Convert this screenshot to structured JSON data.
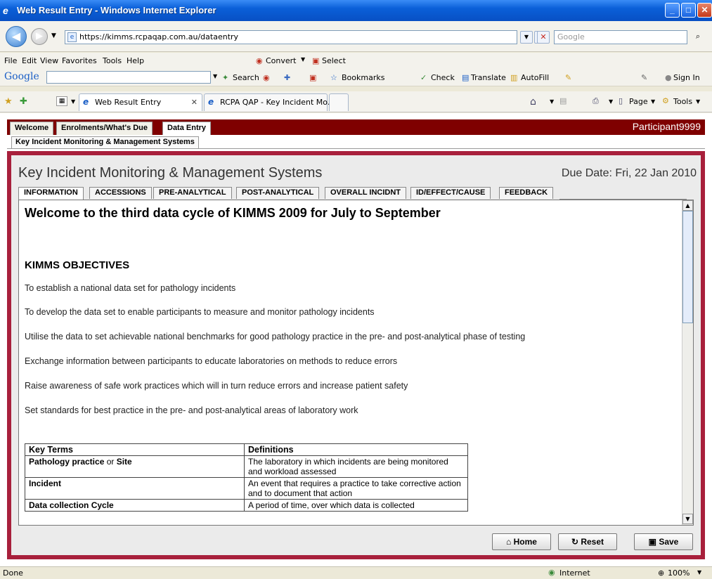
{
  "window": {
    "title": "Web Result Entry - Windows Internet Explorer"
  },
  "address": {
    "url": "https://kimms.rcpaqap.com.au/dataentry",
    "search_placeholder": "Google"
  },
  "menu": [
    "File",
    "Edit",
    "View",
    "Favorites",
    "Tools",
    "Help"
  ],
  "menu_extra": {
    "convert": "Convert",
    "select": "Select"
  },
  "google_bar": {
    "logo": "Google",
    "search": "Search",
    "bookmarks": "Bookmarks",
    "check": "Check",
    "translate": "Translate",
    "autofill": "AutoFill",
    "signin": "Sign In"
  },
  "browser_tabs": [
    {
      "label": "Web Result Entry",
      "active": true
    },
    {
      "label": "RCPA QAP - Key Incident Mo...",
      "active": false
    }
  ],
  "command_bar": {
    "page": "Page",
    "tools": "Tools"
  },
  "site": {
    "tabs": [
      "Welcome",
      "Enrolments/What's Due",
      "Data Entry"
    ],
    "active_tab": "Data Entry",
    "participant": "Participant9999",
    "subtab": "Key Incident Monitoring & Management Systems"
  },
  "panel": {
    "heading": "Key Incident Monitoring & Management Systems",
    "due_date": "Due Date: Fri, 22 Jan 2010",
    "tabs": [
      "INFORMATION",
      "ACCESSIONS",
      "PRE-ANALYTICAL",
      "POST-ANALYTICAL",
      "OVERALL INCIDNT",
      "ID/EFFECT/CAUSE",
      "FEEDBACK"
    ],
    "active_tab": "INFORMATION"
  },
  "content": {
    "welcome": "Welcome to the third data cycle of KIMMS 2009 for July to September",
    "objectives_heading": "KIMMS OBJECTIVES",
    "objectives": [
      "To establish a national data set for pathology incidents",
      "To develop the data set to enable participants to measure and monitor pathology incidents",
      "Utilise the data to set achievable national benchmarks for good pathology practice in the pre- and post-analytical phase of testing",
      "Exchange information between participants to educate laboratories on methods to reduce errors",
      "Raise awareness of safe work practices which will in turn reduce errors and increase patient safety",
      "Set standards for best practice in the pre- and post-analytical areas of laboratory work"
    ],
    "table": {
      "headers": [
        "Key Terms",
        "Definitions"
      ],
      "rows": [
        {
          "term_bold": "Pathology practice",
          "term_join": " or ",
          "term_bold2": "Site",
          "definition": "The laboratory in which incidents are being monitored and workload assessed"
        },
        {
          "term_bold": "Incident",
          "term_join": "",
          "term_bold2": "",
          "definition": "An event that requires a practice to take corrective action and to document that action"
        },
        {
          "term_bold": "Data collection Cycle",
          "term_join": "",
          "term_bold2": "",
          "definition": "A period of time, over which data is collected"
        }
      ]
    }
  },
  "buttons": {
    "home": "Home",
    "reset": "Reset",
    "save": "Save"
  },
  "status": {
    "left": "Done",
    "zone": "Internet",
    "zoom": "100%"
  }
}
